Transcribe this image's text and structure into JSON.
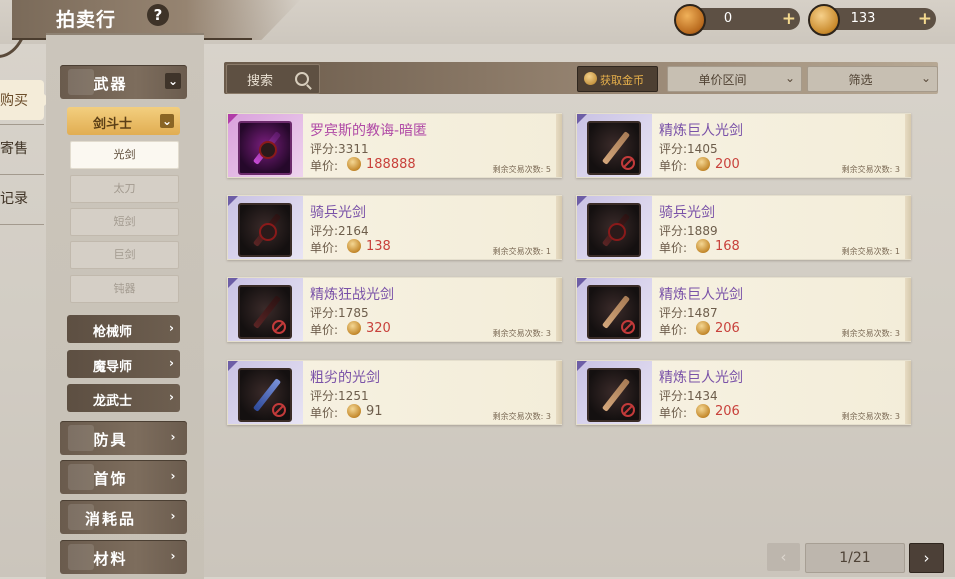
{
  "header": {
    "title": "拍卖行",
    "help_label": "?"
  },
  "currencies": [
    {
      "icon": "crystal-icon",
      "value": "0",
      "plus": "+"
    },
    {
      "icon": "gold-coin-icon",
      "value": "133",
      "plus": "+"
    }
  ],
  "side_tabs": [
    {
      "label": "购买",
      "visible": "购买",
      "shown": "购买"
    },
    {
      "label": "寄售"
    },
    {
      "label": "记录"
    }
  ],
  "side_tab_visible": [
    "购买",
    "寄售",
    "记录"
  ],
  "categories": {
    "weapons": {
      "label": "武器",
      "chevron": "⌄"
    },
    "swordsman": {
      "label": "剑斗士",
      "chevron": "⌄"
    },
    "leaves": [
      "光剑",
      "太刀",
      "短剑",
      "巨剑",
      "钝器"
    ],
    "subclasses": [
      {
        "label": "枪械师",
        "chevron": "›"
      },
      {
        "label": "魔导师",
        "chevron": "›"
      },
      {
        "label": "龙武士",
        "chevron": "›"
      }
    ],
    "main": [
      {
        "label": "防具",
        "chevron": "›"
      },
      {
        "label": "首饰",
        "chevron": "›"
      },
      {
        "label": "消耗品",
        "chevron": "›"
      },
      {
        "label": "材料",
        "chevron": "›"
      }
    ]
  },
  "toolbar": {
    "search_label": "搜索",
    "gold_button_label": "获取金币",
    "price_range_label": "单价区间",
    "filter_label": "筛选",
    "chevron": "⌄"
  },
  "items": [
    {
      "name": "罗宾斯的教诲-暗匿",
      "score": "评分:3311",
      "price_label": "单价:",
      "price": "188888",
      "remaining": "剩余交易次数: 5"
    },
    {
      "name": "精炼巨人光剑",
      "score": "评分:1405",
      "price_label": "单价:",
      "price": "200",
      "remaining": "剩余交易次数: 3"
    },
    {
      "name": "骑兵光剑",
      "score": "评分:2164",
      "price_label": "单价:",
      "price": "138",
      "remaining": "剩余交易次数: 1"
    },
    {
      "name": "骑兵光剑",
      "score": "评分:1889",
      "price_label": "单价:",
      "price": "168",
      "remaining": "剩余交易次数: 1"
    },
    {
      "name": "精炼狂战光剑",
      "score": "评分:1785",
      "price_label": "单价:",
      "price": "320",
      "remaining": "剩余交易次数: 3"
    },
    {
      "name": "精炼巨人光剑",
      "score": "评分:1487",
      "price_label": "单价:",
      "price": "206",
      "remaining": "剩余交易次数: 3"
    },
    {
      "name": "粗劣的光剑",
      "score": "评分:1251",
      "price_label": "单价:",
      "price": "91",
      "remaining": "剩余交易次数: 3"
    },
    {
      "name": "精炼巨人光剑",
      "score": "评分:1434",
      "price_label": "单价:",
      "price": "206",
      "remaining": "剩余交易次数: 3"
    }
  ],
  "pager": {
    "prev": "‹",
    "page_text": "1/21",
    "next": "›"
  },
  "colors": {
    "accent_gold": "#e1ad52",
    "price_red": "#c8413b",
    "rare_purple": "#7a52a8",
    "epic_pink": "#b04aa6"
  }
}
